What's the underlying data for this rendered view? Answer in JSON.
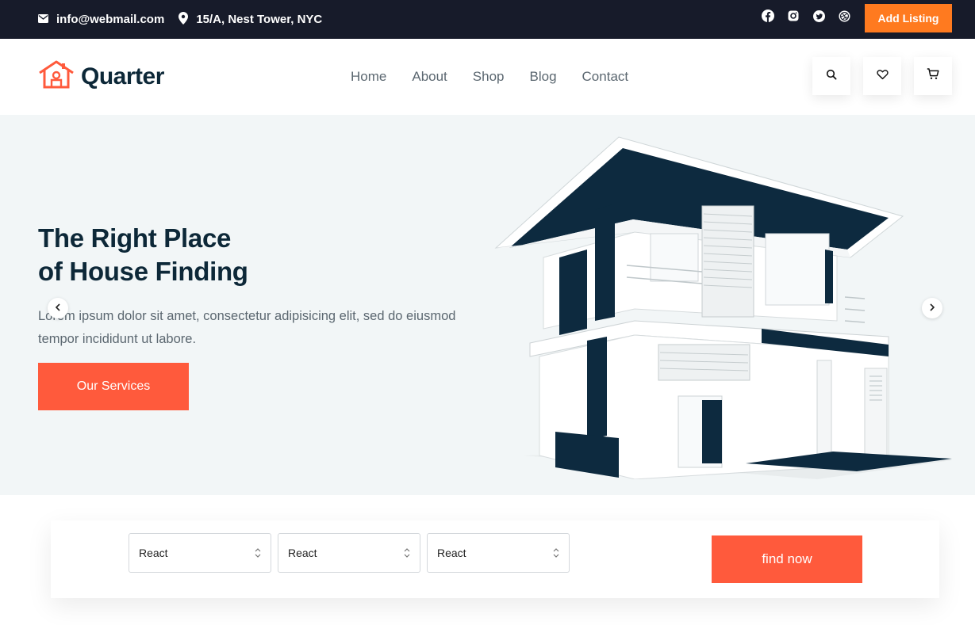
{
  "topbar": {
    "email": "info@webmail.com",
    "address": "15/A, Nest Tower, NYC",
    "socials": [
      "facebook-icon",
      "instagram-icon",
      "twitter-icon",
      "dribbble-icon"
    ],
    "add_listing": "Add Listing"
  },
  "header": {
    "brand": "Quarter",
    "nav": [
      "Home",
      "About",
      "Shop",
      "Blog",
      "Contact"
    ],
    "actions": [
      "search-icon",
      "heart-icon",
      "cart-icon"
    ]
  },
  "hero": {
    "title_line1": "The Right Place",
    "title_line2": "of House Finding",
    "description": "Lorem ipsum dolor sit amet, consectetur adipisicing elit, sed do eiusmod tempor incididunt ut labore.",
    "cta": "Our Services"
  },
  "search": {
    "selects": [
      "React",
      "React",
      "React"
    ],
    "button": "find now"
  },
  "colors": {
    "topbar_bg": "#171b2a",
    "accent_orange": "#ff7a1f",
    "accent_red": "#ff5a3c",
    "dark_navy": "#0d2838",
    "hero_bg": "#f2f6f7"
  }
}
